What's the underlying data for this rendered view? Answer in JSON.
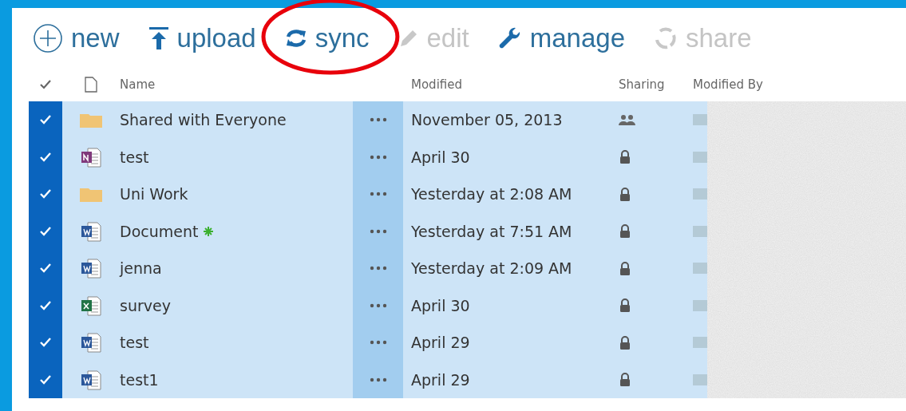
{
  "toolbar": [
    {
      "label": "new",
      "kind": "new",
      "disabled": false
    },
    {
      "label": "upload",
      "kind": "upload",
      "disabled": false
    },
    {
      "label": "sync",
      "kind": "sync",
      "disabled": false,
      "circled": true
    },
    {
      "label": "edit",
      "kind": "edit",
      "disabled": true
    },
    {
      "label": "manage",
      "kind": "manage",
      "disabled": false
    },
    {
      "label": "share",
      "kind": "share",
      "disabled": true
    }
  ],
  "table": {
    "columns": [
      "Name",
      "Modified",
      "Sharing",
      "Modified By"
    ],
    "rows": [
      {
        "selected": true,
        "kind": "folder",
        "name": "Shared with Everyone",
        "is_new": false,
        "modified": "November 05, 2013",
        "shared": true
      },
      {
        "selected": true,
        "kind": "onenote",
        "name": "test",
        "is_new": false,
        "modified": "April 30",
        "shared": false
      },
      {
        "selected": true,
        "kind": "folder",
        "name": "Uni Work",
        "is_new": false,
        "modified": "Yesterday at 2:08 AM",
        "shared": false
      },
      {
        "selected": true,
        "kind": "word",
        "name": "Document",
        "is_new": true,
        "modified": "Yesterday at 7:51 AM",
        "shared": false
      },
      {
        "selected": true,
        "kind": "word",
        "name": "jenna",
        "is_new": false,
        "modified": "Yesterday at 2:09 AM",
        "shared": false
      },
      {
        "selected": true,
        "kind": "excel",
        "name": "survey",
        "is_new": false,
        "modified": "April 30",
        "shared": false
      },
      {
        "selected": true,
        "kind": "word",
        "name": "test",
        "is_new": false,
        "modified": "April 29",
        "shared": false
      },
      {
        "selected": true,
        "kind": "word",
        "name": "test1",
        "is_new": false,
        "modified": "April 29",
        "shared": false
      }
    ]
  }
}
